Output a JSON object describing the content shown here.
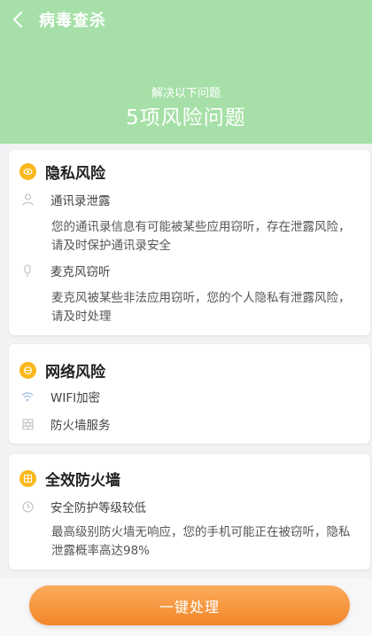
{
  "header": {
    "title": "病毒查杀",
    "subtitle": "解决以下问题",
    "headline": "5项风险问题"
  },
  "cards": {
    "privacy": {
      "title": "隐私风险",
      "items": [
        {
          "label": "通讯录泄露",
          "icon": "contact-icon",
          "description": "您的通讯录信息有可能被某些应用窃听，存在泄露风险，请及时保护通讯录安全"
        },
        {
          "label": "麦克风窃听",
          "icon": "microphone-icon",
          "description": "麦克风被某些非法应用窃听，您的个人隐私有泄露风险，请及时处理"
        }
      ]
    },
    "network": {
      "title": "网络风险",
      "items": [
        {
          "label": "WIFI加密",
          "icon": "wifi-icon"
        },
        {
          "label": "防火墙服务",
          "icon": "firewall-icon"
        }
      ]
    },
    "firewall": {
      "title": "全效防火墙",
      "items": [
        {
          "label": "安全防护等级较低",
          "icon": "clock-icon",
          "description": "最高级别防火墙无响应，您的手机可能正在被窃听，隐私泄露概率高达98%"
        }
      ]
    }
  },
  "action": {
    "label": "一键处理"
  },
  "colors": {
    "header_bg": "#a6e0a8",
    "badge": "#f9b81d",
    "button_start": "#fbab5b",
    "button_end": "#f2862a",
    "page_bg": "#f1f2f4"
  }
}
